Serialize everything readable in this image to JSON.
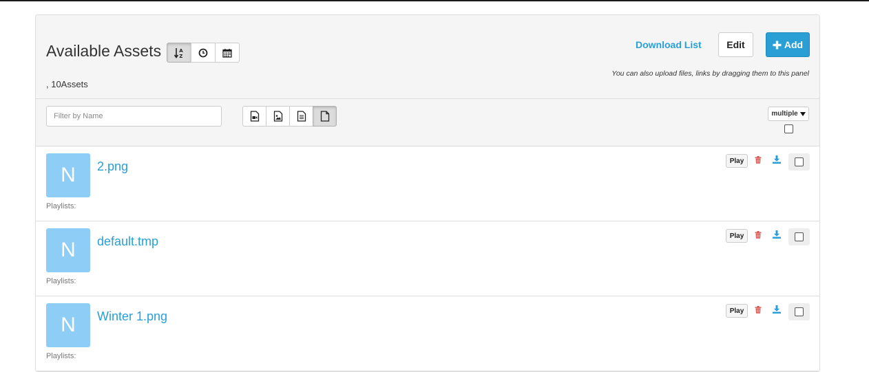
{
  "header": {
    "title": "Available Assets",
    "count_text": ", 10Assets",
    "download_list_label": "Download List",
    "edit_label": "Edit",
    "add_label": "Add",
    "upload_hint": "You can also upload files, links by dragging them to this panel",
    "sort_options": [
      "sort-alpha-icon",
      "clock-icon",
      "calendar-icon"
    ],
    "sort_active": "sort-alpha-icon"
  },
  "filter": {
    "placeholder": "Filter by Name",
    "value": "",
    "type_options": [
      "video-file-icon",
      "image-file-icon",
      "text-file-icon",
      "blank-file-icon"
    ],
    "type_active": "blank-file-icon",
    "multiple_label": "multiple"
  },
  "assets": [
    {
      "thumb_letter": "N",
      "name": "2.png",
      "playlists_label": "Playlists:",
      "play_label": "Play"
    },
    {
      "thumb_letter": "N",
      "name": "default.tmp",
      "playlists_label": "Playlists:",
      "play_label": "Play"
    },
    {
      "thumb_letter": "N",
      "name": "Winter 1.png",
      "playlists_label": "Playlists:",
      "play_label": "Play"
    }
  ],
  "colors": {
    "accent": "#2a9fd6",
    "thumb_bg": "#8ecdf6",
    "delete": "#d9534f",
    "panel_bg": "#f5f5f5"
  }
}
